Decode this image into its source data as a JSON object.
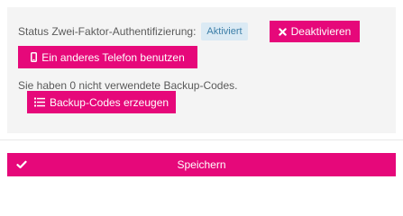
{
  "two_factor": {
    "status_label": "Status Zwei-Faktor-Authentifizierung:",
    "status_badge": "Aktiviert",
    "deactivate_label": "Deaktivieren",
    "other_phone_label": "Ein anderes Telefon benutzen",
    "backup_info": "Sie haben 0 nicht verwendete Backup-Codes.",
    "generate_backup_label": "Backup-Codes erzeugen"
  },
  "form": {
    "save_label": "Speichern"
  },
  "icons": {
    "deactivate": "times-icon",
    "phone": "mobile-phone-icon",
    "backup": "list-icon",
    "save": "check-icon"
  },
  "colors": {
    "accent": "#e6087a",
    "panel_background": "#f4f4f4",
    "badge_background": "#dbeaf4",
    "badge_text": "#3d7fa8"
  }
}
